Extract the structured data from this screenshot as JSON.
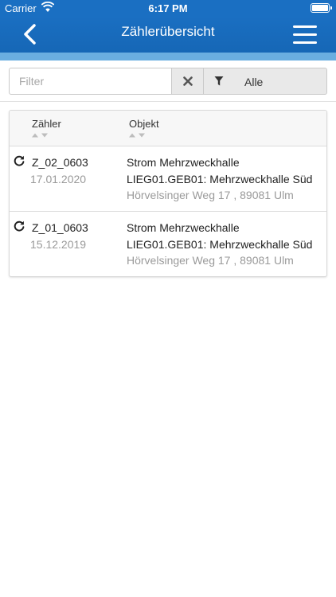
{
  "status_bar": {
    "carrier": "Carrier",
    "time": "6:17 PM"
  },
  "nav": {
    "title": "Zählerübersicht",
    "back_icon": "chevron-left-icon",
    "menu_icon": "hamburger-menu-icon"
  },
  "filter": {
    "placeholder": "Filter",
    "value": "",
    "clear_icon": "close-icon",
    "filter_icon": "funnel-icon",
    "selected_option": "Alle"
  },
  "table": {
    "columns": [
      "Zähler",
      "Objekt"
    ],
    "rows": [
      {
        "meter_id": "Z_02_0603",
        "date": "17.01.2020",
        "object_name": "Strom Mehrzweckhalle",
        "object_code": "LIEG01.GEB01: Mehrzweckhalle Süd",
        "address": "Hörvelsinger Weg 17 , 89081 Ulm"
      },
      {
        "meter_id": "Z_01_0603",
        "date": "15.12.2019",
        "object_name": "Strom Mehrzweckhalle",
        "object_code": "LIEG01.GEB01: Mehrzweckhalle Süd",
        "address": "Hörvelsinger Weg 17 , 89081 Ulm"
      }
    ]
  },
  "colors": {
    "nav_blue": "#1a6fc2",
    "accent_strip": "#6aaee0",
    "muted_text": "#9a9a9a"
  }
}
